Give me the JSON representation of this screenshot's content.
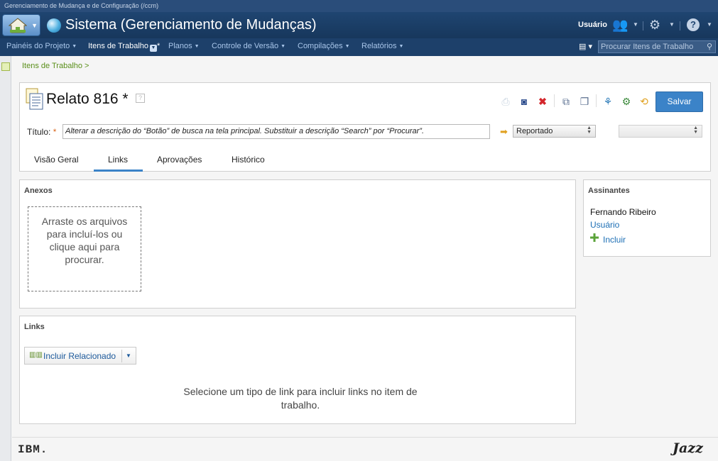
{
  "window": {
    "subtitle": "Gerenciamento de Mudança e de Configuração (/ccm)"
  },
  "app": {
    "title": "Sistema (Gerenciamento de Mudanças)",
    "user": "Usuário"
  },
  "nav": {
    "items": [
      "Painéis do Projeto",
      "Itens de Trabalho",
      "Planos",
      "Controle de Versão",
      "Compilações",
      "Relatórios"
    ],
    "active_marker": "*",
    "search_placeholder": "Procurar Itens de Trabalho"
  },
  "breadcrumb": "Itens de Trabalho >",
  "work_item": {
    "title": "Relato 816 *",
    "help": "?",
    "save_label": "Salvar",
    "title_label": "Título:",
    "required_mark": "*",
    "title_value": "Alterar a descrição do “Botão” de busca na tela principal. Substituir a descrição “Search” por “Procurar”.",
    "state": "Reportado",
    "resolution": ""
  },
  "tabs": [
    "Visão Geral",
    "Links",
    "Aprovações",
    "Histórico"
  ],
  "active_tab": "Links",
  "attachments": {
    "title": "Anexos",
    "drop_text": [
      "Arraste os arquivos",
      "para incluí-los ou",
      "clique aqui para",
      "procurar."
    ]
  },
  "links": {
    "title": "Links",
    "add_button": "Incluir Relacionado",
    "message_lines": [
      "Selecione um tipo de link para incluir links no item de",
      "trabalho."
    ]
  },
  "subscribers": {
    "title": "Assinantes",
    "name": "Fernando Ribeiro",
    "user_link": "Usuário",
    "add_label": "Incluir"
  },
  "footer": {
    "ibm": "IBM.",
    "jazz": "Jazz"
  },
  "colors": {
    "accent": "#3b83c8",
    "banner": "#1f4571",
    "navbar": "#1d406a",
    "breadcrumb": "#5a8f1a"
  }
}
